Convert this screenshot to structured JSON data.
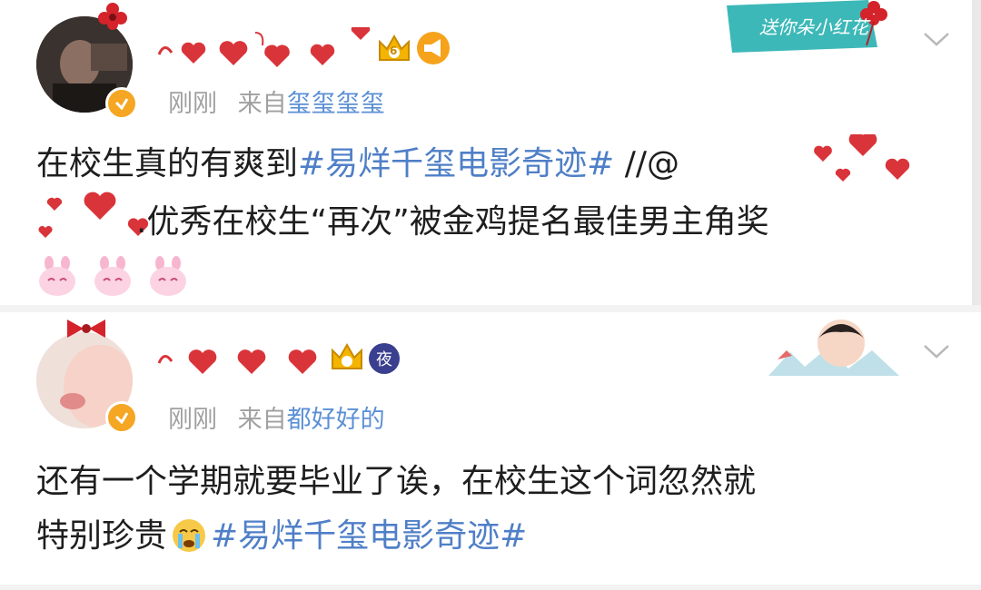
{
  "post1": {
    "time": "刚刚",
    "via_prefix": "来自",
    "source": "玺玺玺玺",
    "body_line1_text": "在校生真的有爽到",
    "body_line1_tag": "#易烊千玺电影奇迹#",
    "body_line1_mention": " //@",
    "body_line2_text": ".优秀在校生“再次”被金鸡提名最佳男主角奖",
    "crown_badge_text": "6",
    "decor_text": "送你朵小红花"
  },
  "post2": {
    "time": "刚刚",
    "via_prefix": "来自",
    "source": "都好好的",
    "body_line1_text": "还有一个学期就要毕业了诶，在校生这个词忽然就",
    "body_line2_text": "特别珍贵",
    "body_line2_tag": "#易烊千玺电影奇迹#",
    "night_badge_text": "夜"
  },
  "icons": {
    "expand": "chevron-down-icon",
    "verified": "verified-badge-icon",
    "crown": "crown-icon",
    "megaphone": "megaphone-icon",
    "bunny": "bunny-emoji-icon",
    "crying": "crying-emoji-icon"
  },
  "colors": {
    "hashtag": "#4f7fc7",
    "source": "#5b8fd4",
    "meta": "#a0a0a0",
    "heart": "#d9343a",
    "verified": "#f5a623"
  }
}
